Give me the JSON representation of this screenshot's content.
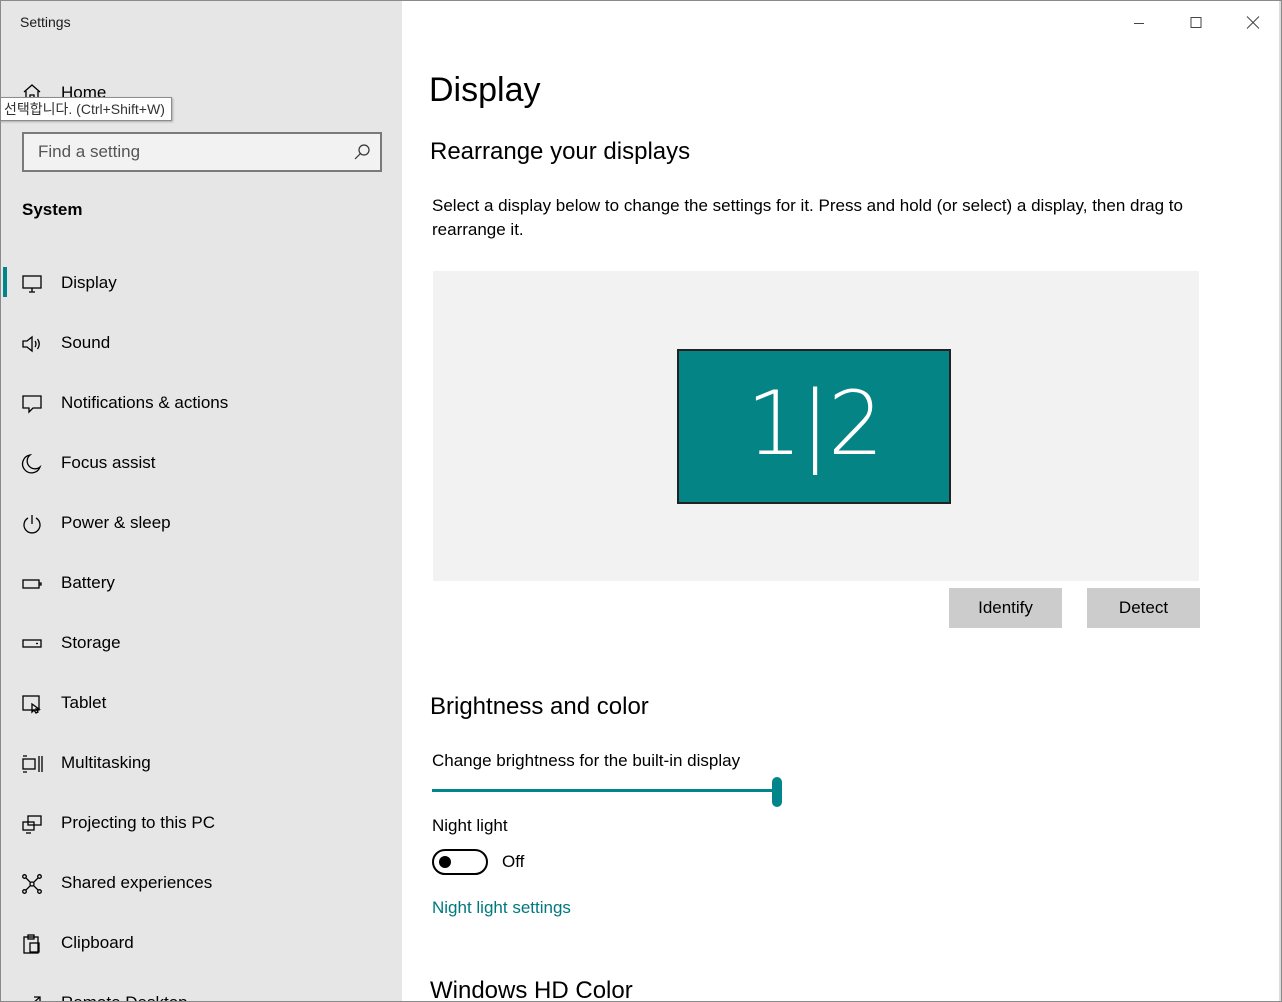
{
  "window": {
    "app_title": "Settings"
  },
  "sidebar": {
    "home_label": "Home",
    "tooltip": "선택합니다. (Ctrl+Shift+W)",
    "search_placeholder": "Find a setting",
    "section_label": "System",
    "items": [
      {
        "label": "Display",
        "icon": "monitor-icon",
        "active": true
      },
      {
        "label": "Sound",
        "icon": "speaker-icon"
      },
      {
        "label": "Notifications & actions",
        "icon": "notification-icon"
      },
      {
        "label": "Focus assist",
        "icon": "moon-icon"
      },
      {
        "label": "Power & sleep",
        "icon": "power-icon"
      },
      {
        "label": "Battery",
        "icon": "battery-icon"
      },
      {
        "label": "Storage",
        "icon": "storage-icon"
      },
      {
        "label": "Tablet",
        "icon": "tablet-icon"
      },
      {
        "label": "Multitasking",
        "icon": "multitasking-icon"
      },
      {
        "label": "Projecting to this PC",
        "icon": "projecting-icon"
      },
      {
        "label": "Shared experiences",
        "icon": "shared-experiences-icon"
      },
      {
        "label": "Clipboard",
        "icon": "clipboard-icon"
      },
      {
        "label": "Remote Desktop",
        "icon": "remote-desktop-icon"
      }
    ]
  },
  "main": {
    "page_title": "Display",
    "rearrange": {
      "heading": "Rearrange your displays",
      "description": "Select a display below to change the settings for it. Press and hold (or select) a display, then drag to rearrange it.",
      "monitor_label": "1|2",
      "identify_label": "Identify",
      "detect_label": "Detect"
    },
    "brightness": {
      "heading": "Brightness and color",
      "slider_label": "Change brightness for the built-in display",
      "slider_value_percent": 100,
      "night_light_label": "Night light",
      "night_light_state": "Off",
      "night_light_on": false,
      "night_light_settings_link": "Night light settings"
    },
    "hd_color": {
      "heading": "Windows HD Color"
    }
  },
  "colors": {
    "accent": "#00868a",
    "monitor_fill": "#058486",
    "sidebar_bg": "#e6e6e6"
  }
}
